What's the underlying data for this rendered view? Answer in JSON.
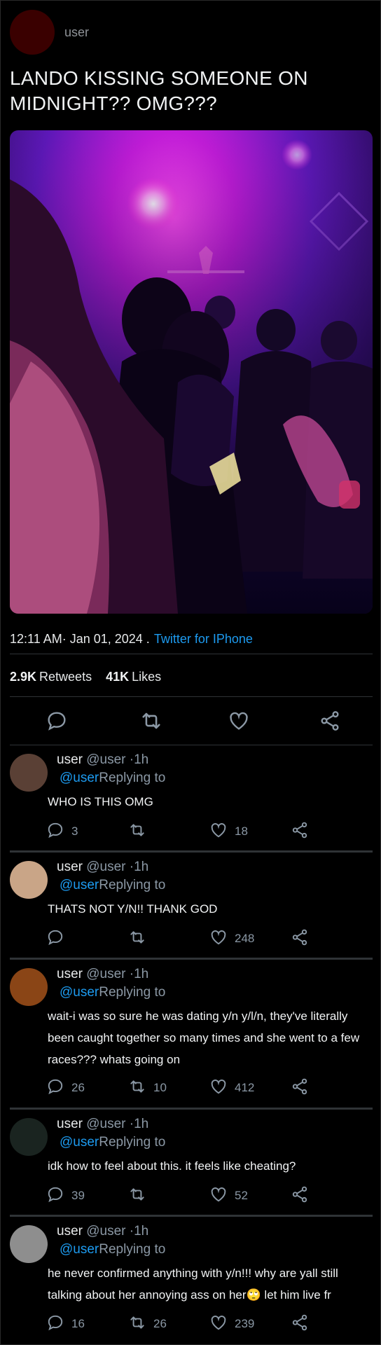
{
  "colors": {
    "background": "#000000",
    "link": "#1d9bf0",
    "muted": "#8b98a5",
    "divider": "#2f3336"
  },
  "tweet": {
    "author_name": "user",
    "avatar_color": "#3a0000",
    "text": "LANDO KISSING SOMEONE ON MIDNIGHT?? OMG???",
    "time": "12:11 AM· Jan 01, 2024 .",
    "client": "Twitter for IPhone",
    "retweets_count": "2.9K",
    "retweets_label": "Retweets",
    "likes_count": "41K",
    "likes_label": "Likes",
    "icons": [
      "reply-icon",
      "retweet-icon",
      "like-icon",
      "share-icon"
    ]
  },
  "replies": [
    {
      "name": "user",
      "handle": "@user",
      "time": "·1h",
      "mention": "@user",
      "replying_to": "Replying to",
      "avatar_color": "#5a4035",
      "text": "WHO IS THIS OMG",
      "reply_count": "3",
      "retweet_count": "",
      "like_count": "18"
    },
    {
      "name": "user",
      "handle": "@user",
      "time": "·1h",
      "mention": "@user",
      "replying_to": "Replying to",
      "avatar_color": "#c9a587",
      "text": "THATS NOT Y/N!! THANK GOD",
      "reply_count": "",
      "retweet_count": "",
      "like_count": "248"
    },
    {
      "name": "user",
      "handle": "@user",
      "time": "·1h",
      "mention": "@user",
      "replying_to": "Replying to",
      "avatar_color": "#8a4516",
      "text": "wait-i was so sure he was dating y/n y/l/n, they've literally been caught together so many times and she went to a few races??? whats going on",
      "reply_count": "26",
      "retweet_count": "10",
      "like_count": "412"
    },
    {
      "name": "user",
      "handle": "@user",
      "time": "·1h",
      "mention": "@user",
      "replying_to": "Replying to",
      "avatar_color": "#1a2420",
      "text": "idk how to feel about this. it feels like cheating?",
      "reply_count": "39",
      "retweet_count": "",
      "like_count": "52"
    },
    {
      "name": "user",
      "handle": "@user",
      "time": "·1h",
      "mention": "@user",
      "replying_to": "Replying to",
      "avatar_color": "#8e8e8e",
      "text": "he never confirmed anything with y/n!!! why are yall still talking about her annoying ass on her🙄 let him live fr",
      "reply_count": "16",
      "retweet_count": "26",
      "like_count": "239"
    }
  ]
}
